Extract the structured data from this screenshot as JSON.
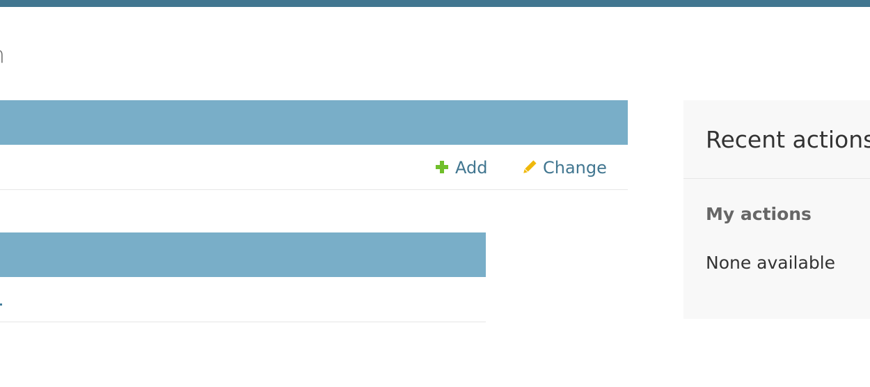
{
  "header": {
    "title_fragment": "on"
  },
  "module1": {
    "actions": {
      "add_label": "Add",
      "change_label": "Change",
      "add_icon": "plus-icon",
      "change_icon": "pencil-icon"
    }
  },
  "sidebar": {
    "title": "Recent actions",
    "subtitle": "My actions",
    "empty_text": "None available"
  },
  "colors": {
    "topbar": "#417690",
    "module_header": "#79aec8",
    "link": "#417690",
    "add_icon": "#70bf2b",
    "change_icon": "#efb80b",
    "sidebar_bg": "#f8f8f8"
  }
}
